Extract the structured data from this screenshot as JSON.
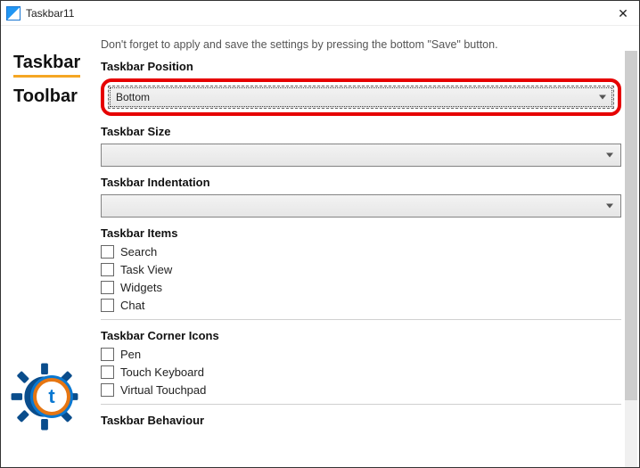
{
  "window": {
    "title": "Taskbar11"
  },
  "sidebar": {
    "tabs": [
      {
        "label": "Taskbar"
      },
      {
        "label": "Toolbar"
      }
    ]
  },
  "main": {
    "hint": "Don't forget to apply and save the settings by pressing the bottom \"Save\" button.",
    "position": {
      "label": "Taskbar Position",
      "value": "Bottom"
    },
    "size": {
      "label": "Taskbar Size",
      "value": ""
    },
    "indentation": {
      "label": "Taskbar Indentation",
      "value": ""
    },
    "items": {
      "label": "Taskbar Items",
      "checks": [
        {
          "label": "Search"
        },
        {
          "label": "Task View"
        },
        {
          "label": "Widgets"
        },
        {
          "label": "Chat"
        }
      ]
    },
    "cornerIcons": {
      "label": "Taskbar Corner Icons",
      "checks": [
        {
          "label": "Pen"
        },
        {
          "label": "Touch Keyboard"
        },
        {
          "label": "Virtual Touchpad"
        }
      ]
    },
    "behaviour": {
      "label": "Taskbar Behaviour"
    }
  },
  "badge": {
    "letter": "t"
  }
}
